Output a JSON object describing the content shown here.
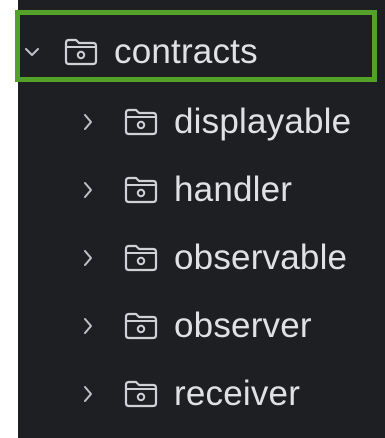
{
  "tree": {
    "root": {
      "label": "contracts",
      "expanded": true,
      "chevron_icon": "chevron-down-icon",
      "folder_icon": "folder-icon",
      "selected": true
    },
    "children": [
      {
        "label": "displayable",
        "chevron_icon": "chevron-right-icon",
        "folder_icon": "folder-icon"
      },
      {
        "label": "handler",
        "chevron_icon": "chevron-right-icon",
        "folder_icon": "folder-icon"
      },
      {
        "label": "observable",
        "chevron_icon": "chevron-right-icon",
        "folder_icon": "folder-icon"
      },
      {
        "label": "observer",
        "chevron_icon": "chevron-right-icon",
        "folder_icon": "folder-icon"
      },
      {
        "label": "receiver",
        "chevron_icon": "chevron-right-icon",
        "folder_icon": "folder-icon"
      }
    ]
  },
  "colors": {
    "background": "#1e1f22",
    "text": "#dfe1e5",
    "icon": "#cfd1d6",
    "selection_border": "#53a128"
  }
}
